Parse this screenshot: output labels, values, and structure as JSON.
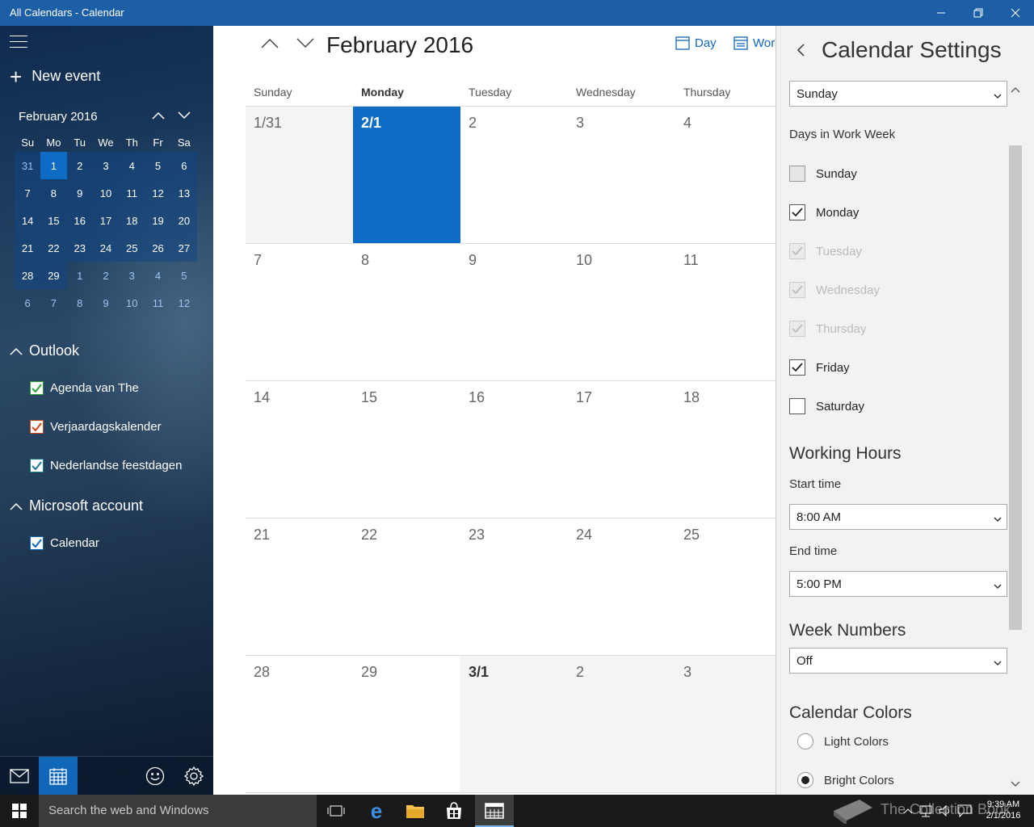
{
  "window": {
    "title": "All Calendars - Calendar"
  },
  "sidebar": {
    "new_event": "New event",
    "mini_calendar": {
      "month_label": "February 2016",
      "weekday_headers": [
        "Su",
        "Mo",
        "Tu",
        "We",
        "Th",
        "Fr",
        "Sa"
      ],
      "weeks": [
        [
          "31",
          "1",
          "2",
          "3",
          "4",
          "5",
          "6"
        ],
        [
          "7",
          "8",
          "9",
          "10",
          "11",
          "12",
          "13"
        ],
        [
          "14",
          "15",
          "16",
          "17",
          "18",
          "19",
          "20"
        ],
        [
          "21",
          "22",
          "23",
          "24",
          "25",
          "26",
          "27"
        ],
        [
          "28",
          "29",
          "1",
          "2",
          "3",
          "4",
          "5"
        ],
        [
          "6",
          "7",
          "8",
          "9",
          "10",
          "11",
          "12"
        ]
      ],
      "selected_day": "1"
    },
    "groups": [
      {
        "name": "Outlook",
        "calendars": [
          {
            "name": "Agenda van The",
            "color": "#2e9e3a",
            "checked": true
          },
          {
            "name": "Verjaardagskalender",
            "color": "#d0441c",
            "checked": true
          },
          {
            "name": "Nederlandse feestdagen",
            "color": "#1f7a8c",
            "checked": true
          }
        ]
      },
      {
        "name": "Microsoft account",
        "calendars": [
          {
            "name": "Calendar",
            "color": "#1066b8",
            "checked": true
          }
        ]
      }
    ]
  },
  "main": {
    "month_title": "February 2016",
    "views": [
      {
        "label": "Day"
      },
      {
        "label": "Work"
      }
    ],
    "day_headers": [
      "Sunday",
      "Monday",
      "Tuesday",
      "Wednesday",
      "Thursday"
    ],
    "weeks": [
      [
        "1/31",
        "2/1",
        "2",
        "3",
        "4"
      ],
      [
        "7",
        "8",
        "9",
        "10",
        "11"
      ],
      [
        "14",
        "15",
        "16",
        "17",
        "18"
      ],
      [
        "21",
        "22",
        "23",
        "24",
        "25"
      ],
      [
        "28",
        "29",
        "3/1",
        "2",
        "3"
      ]
    ]
  },
  "settings": {
    "title": "Calendar Settings",
    "first_day_value": "Sunday",
    "work_week_label": "Days in Work Week",
    "work_days": [
      {
        "name": "Sunday",
        "checked": false,
        "disabled": false
      },
      {
        "name": "Monday",
        "checked": true,
        "disabled": false
      },
      {
        "name": "Tuesday",
        "checked": true,
        "disabled": true
      },
      {
        "name": "Wednesday",
        "checked": true,
        "disabled": true
      },
      {
        "name": "Thursday",
        "checked": true,
        "disabled": true
      },
      {
        "name": "Friday",
        "checked": true,
        "disabled": false
      },
      {
        "name": "Saturday",
        "checked": false,
        "disabled": false
      }
    ],
    "working_hours_heading": "Working Hours",
    "start_time_label": "Start time",
    "start_time_value": "8:00 AM",
    "end_time_label": "End time",
    "end_time_value": "5:00 PM",
    "week_numbers_heading": "Week Numbers",
    "week_numbers_value": "Off",
    "calendar_colors_heading": "Calendar Colors",
    "color_options": [
      {
        "label": "Light Colors",
        "selected": false
      },
      {
        "label": "Bright Colors",
        "selected": true
      }
    ]
  },
  "taskbar": {
    "search_placeholder": "Search the web and Windows",
    "time": "9:39 AM",
    "date": "2/1/2016"
  },
  "watermark": "The Collection Book",
  "colors": {
    "accent": "#1066b8",
    "titlebar": "#1d5fa6",
    "today": "#0e6cc4"
  }
}
